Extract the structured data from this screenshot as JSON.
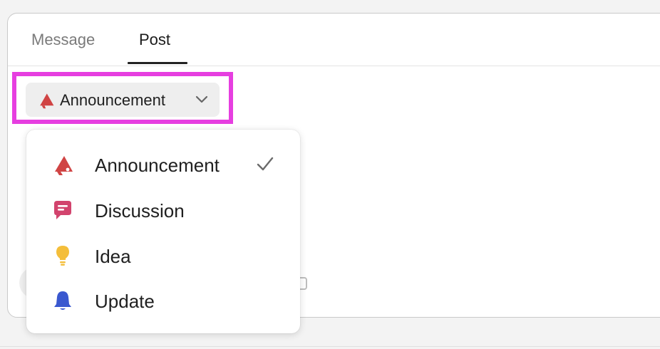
{
  "colors": {
    "highlight": "#e63ee0",
    "announcement": "#d04444",
    "discussion": "#d2436d",
    "idea": "#f4be3a",
    "update": "#3a58cf"
  },
  "tabs": [
    {
      "label": "Message",
      "active": false
    },
    {
      "label": "Post",
      "active": true
    }
  ],
  "post_type_selector": {
    "label": "Announcement",
    "icon": "megaphone-icon"
  },
  "dropdown": {
    "items": [
      {
        "label": "Announcement",
        "icon": "megaphone-icon",
        "selected": true
      },
      {
        "label": "Discussion",
        "icon": "chat-bubble-icon",
        "selected": false
      },
      {
        "label": "Idea",
        "icon": "lightbulb-icon",
        "selected": false
      },
      {
        "label": "Update",
        "icon": "bell-icon",
        "selected": false
      }
    ]
  }
}
